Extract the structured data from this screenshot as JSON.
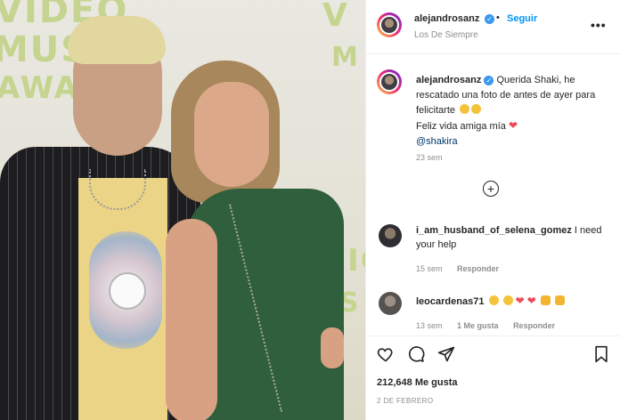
{
  "post": {
    "author": "alejandrosanz",
    "follow_label": "Seguir",
    "location": "Los De Siempre",
    "more_menu": "•••"
  },
  "caption": {
    "author": "alejandrosanz",
    "line1": "Querida Shaki, he rescatado una foto de antes de ayer para felicitarte",
    "line2": "Feliz vida amiga mía",
    "mention": "@shakira",
    "time": "23 sem"
  },
  "comments": [
    {
      "user": "i_am_husband_of_selena_gomez",
      "text": "I need your help",
      "time": "15 sem",
      "reply": "Responder"
    },
    {
      "user": "leocardenas71",
      "text": "",
      "time": "13 sem",
      "likes": "1 Me gusta",
      "reply": "Responder"
    }
  ],
  "photo_backdrop": {
    "word1": "VIDEO",
    "word2": "MUSIC",
    "word3": "AWARDS",
    "right1": "VIDEO",
    "right2": "MUSIC",
    "right3": "AWARDS"
  },
  "footer": {
    "likes": "212,648 Me gusta",
    "date": "2 DE FEBRERO"
  },
  "colors": {
    "link_blue": "#0095f6",
    "verified_blue": "#3897f0",
    "mention_blue": "#00376b",
    "heart_red": "#ed4956"
  },
  "icons": [
    "verified-icon",
    "more-options-icon",
    "load-more-icon",
    "heart-icon",
    "comment-icon",
    "share-icon",
    "save-icon"
  ]
}
